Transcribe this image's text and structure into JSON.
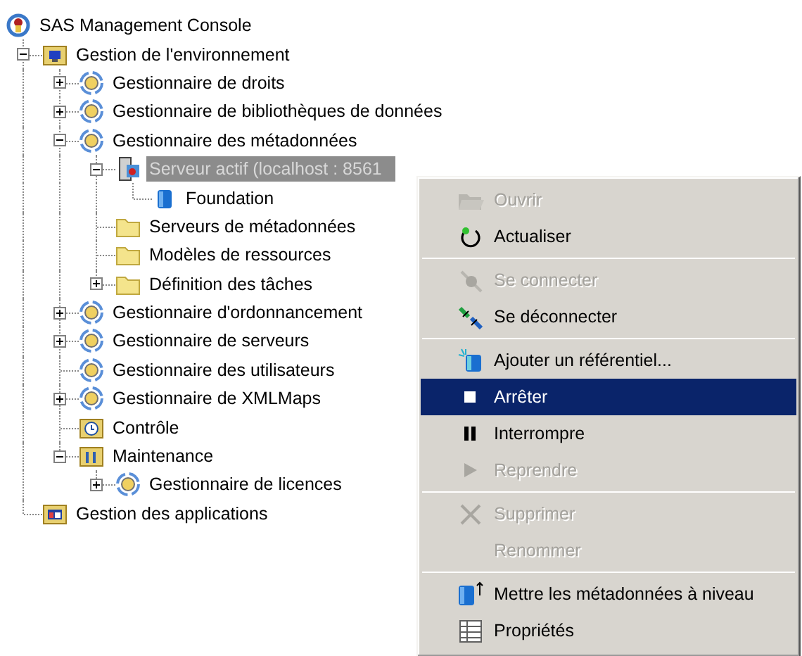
{
  "tree": {
    "label": "SAS Management Console",
    "kind": "console",
    "selected": false,
    "children": [
      {
        "label": "Gestion de l'environnement",
        "kind": "computer-folder",
        "expanded": true,
        "selected": false,
        "children": [
          {
            "label": "Gestionnaire de droits",
            "kind": "plugin",
            "expanded": false,
            "selected": false
          },
          {
            "label": "Gestionnaire de bibliothèques de données",
            "kind": "plugin",
            "expanded": false,
            "selected": false
          },
          {
            "label": "Gestionnaire des métadonnées",
            "kind": "plugin",
            "expanded": true,
            "selected": false,
            "children": [
              {
                "label": "Serveur actif (localhost : 8561",
                "kind": "server",
                "expanded": true,
                "selected": true,
                "children": [
                  {
                    "label": "Foundation",
                    "kind": "database",
                    "selected": false
                  }
                ]
              },
              {
                "label": "Serveurs de métadonnées",
                "kind": "folder",
                "selected": false
              },
              {
                "label": "Modèles de ressources",
                "kind": "folder",
                "selected": false
              },
              {
                "label": "Définition des tâches",
                "kind": "folder",
                "expanded": false,
                "selected": false
              }
            ]
          },
          {
            "label": "Gestionnaire d'ordonnancement",
            "kind": "plugin",
            "expanded": false,
            "selected": false
          },
          {
            "label": "Gestionnaire de serveurs",
            "kind": "plugin",
            "expanded": false,
            "selected": false
          },
          {
            "label": "Gestionnaire des utilisateurs",
            "kind": "plugin",
            "selected": false
          },
          {
            "label": "Gestionnaire de XMLMaps",
            "kind": "plugin",
            "expanded": false,
            "selected": false
          },
          {
            "label": "Contrôle",
            "kind": "clock-folder",
            "selected": false
          },
          {
            "label": "Maintenance",
            "kind": "tools-folder",
            "expanded": true,
            "selected": false,
            "children": [
              {
                "label": "Gestionnaire de licences",
                "kind": "plugin",
                "expanded": false,
                "selected": false
              }
            ]
          }
        ]
      },
      {
        "label": "Gestion des applications",
        "kind": "app-folder",
        "selected": false
      }
    ]
  },
  "context_menu": {
    "items": [
      {
        "kind": "open",
        "label": "Ouvrir",
        "disabled": true,
        "selected": false
      },
      {
        "kind": "refresh",
        "label": "Actualiser",
        "disabled": false,
        "selected": false
      },
      {
        "kind": "separator"
      },
      {
        "kind": "connect",
        "label": "Se connecter",
        "disabled": true,
        "selected": false
      },
      {
        "kind": "disconnect",
        "label": "Se déconnecter",
        "disabled": false,
        "selected": false
      },
      {
        "kind": "separator"
      },
      {
        "kind": "add",
        "label": "Ajouter un référentiel...",
        "disabled": false,
        "selected": false
      },
      {
        "kind": "stop",
        "label": "Arrêter",
        "disabled": false,
        "selected": true
      },
      {
        "kind": "pause",
        "label": "Interrompre",
        "disabled": false,
        "selected": false
      },
      {
        "kind": "play",
        "label": "Reprendre",
        "disabled": true,
        "selected": false
      },
      {
        "kind": "separator"
      },
      {
        "kind": "delete",
        "label": "Supprimer",
        "disabled": true,
        "selected": false
      },
      {
        "kind": "plain",
        "label": "Renommer",
        "disabled": true,
        "selected": false
      },
      {
        "kind": "separator"
      },
      {
        "kind": "upgrade",
        "label": "Mettre les métadonnées à niveau",
        "disabled": false,
        "selected": false
      },
      {
        "kind": "properties",
        "label": "Propriétés",
        "disabled": false,
        "selected": false
      }
    ]
  }
}
